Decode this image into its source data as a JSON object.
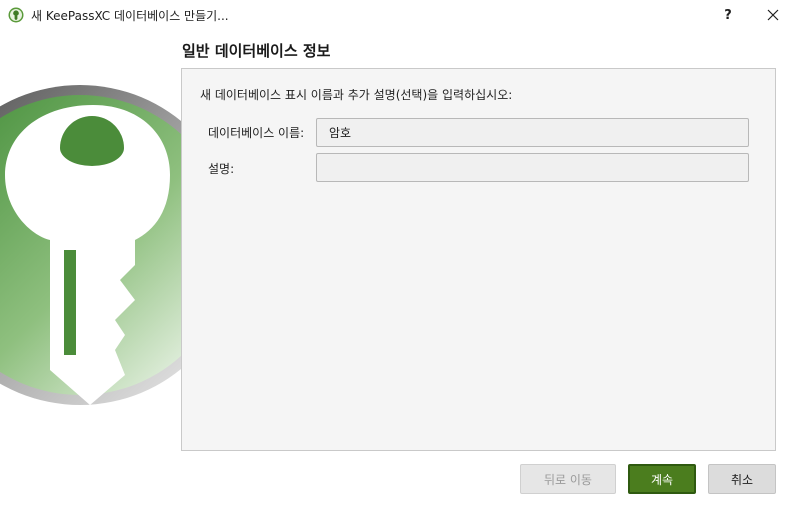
{
  "window": {
    "title": "새 KeePassXC 데이터베이스 만들기...",
    "help_label": "?",
    "icon": "keepassxc-logo-icon",
    "close_icon": "close-icon"
  },
  "page": {
    "title": "일반 데이터베이스 정보",
    "instruction": "새 데이터베이스 표시 이름과 추가 설명(선택)을 입력하십시오:"
  },
  "form": {
    "name_label": "데이터베이스 이름:",
    "name_value": "암호",
    "description_label": "설명:",
    "description_value": ""
  },
  "buttons": {
    "back_label": "뒤로 이동",
    "continue_label": "계속",
    "cancel_label": "취소"
  },
  "colors": {
    "accent": "#4b7d1e",
    "brand_green": "#5a9a3a"
  }
}
